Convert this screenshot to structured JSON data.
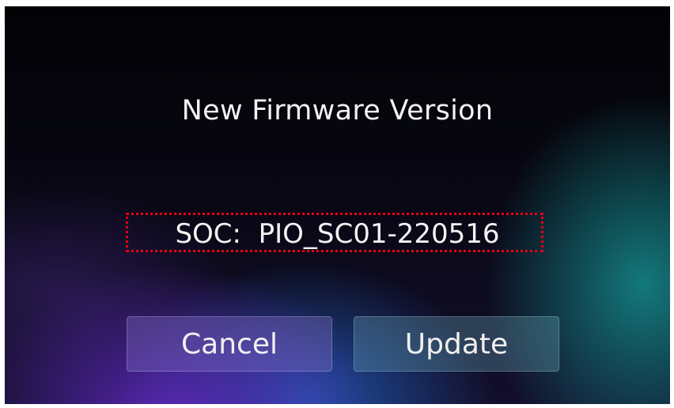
{
  "dialog": {
    "title": "New Firmware Version",
    "version_label": "SOC:",
    "version_value": "PIO_SC01-220516"
  },
  "buttons": {
    "cancel_label": "Cancel",
    "update_label": "Update"
  },
  "colors": {
    "highlight_border": "#e60012",
    "text": "#f3f3f3"
  }
}
